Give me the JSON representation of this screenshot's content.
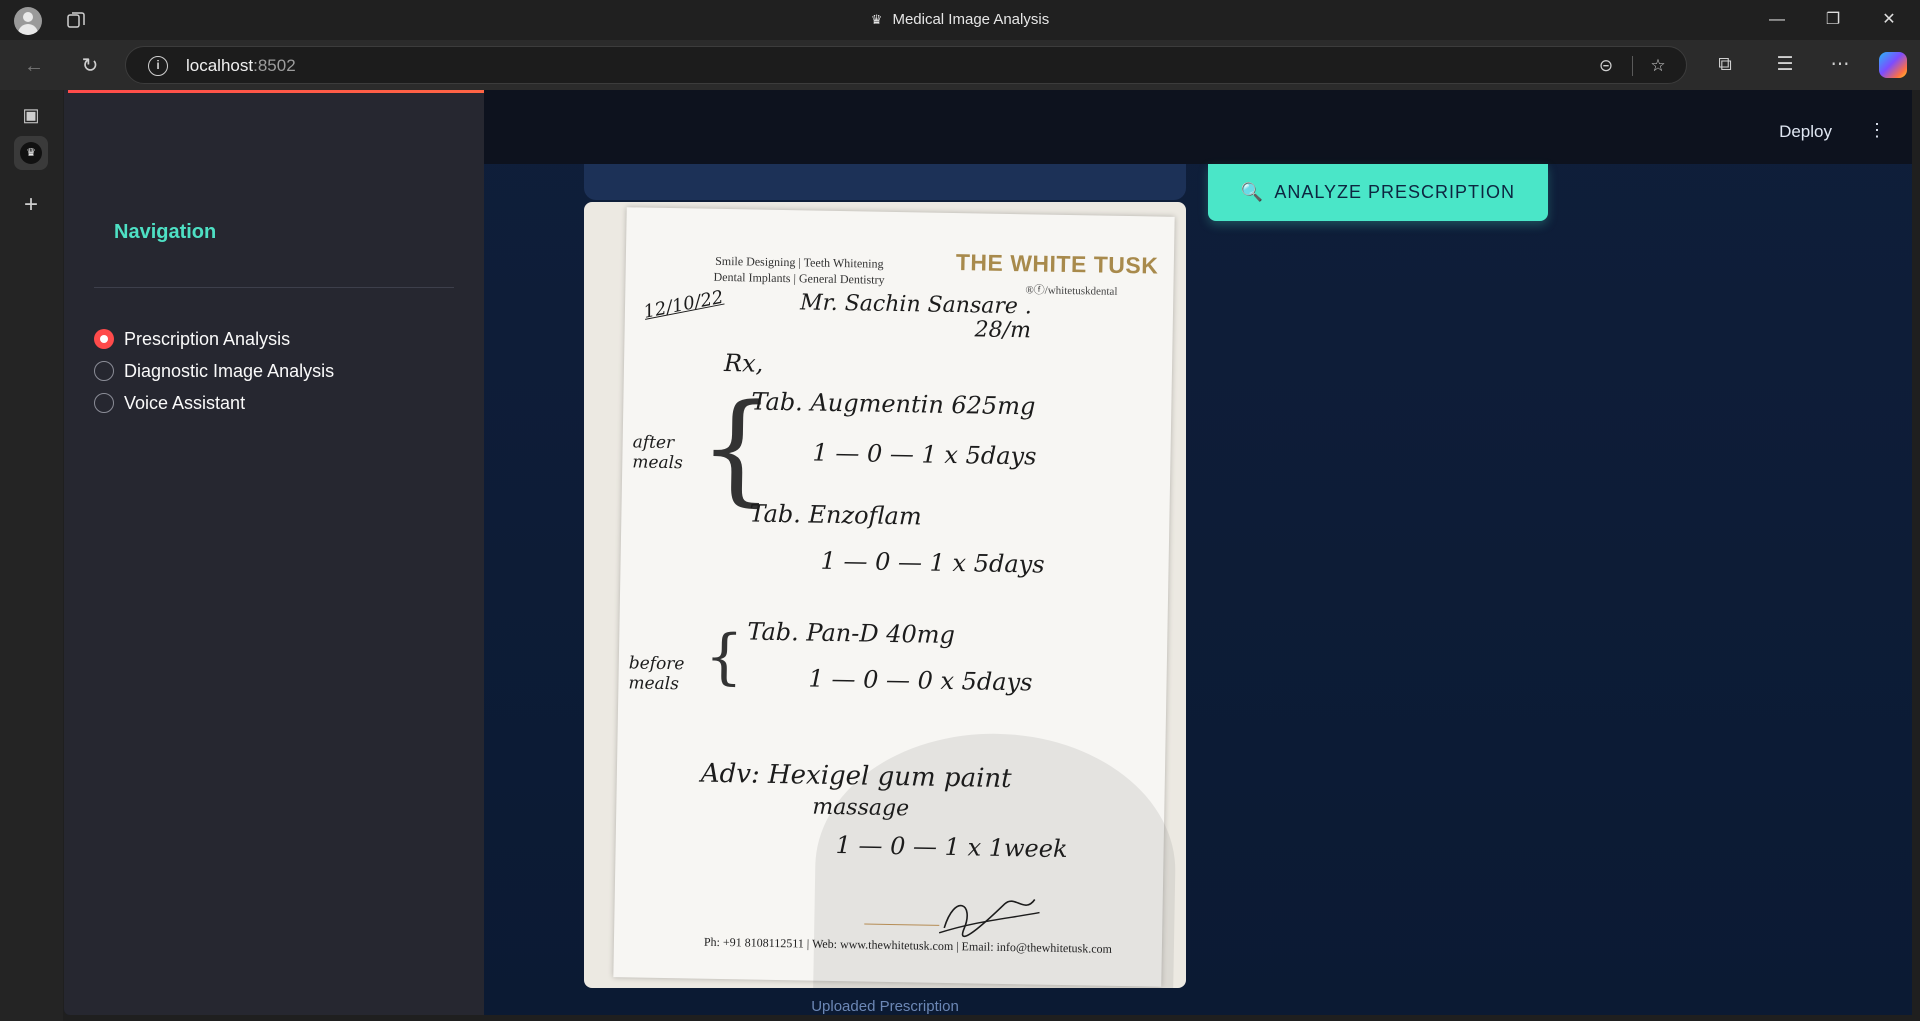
{
  "window": {
    "title": "Medical Image Analysis"
  },
  "address": {
    "host": "localhost",
    "port": ":8502"
  },
  "sidebar": {
    "title": "Navigation",
    "options": [
      {
        "label": "Prescription Analysis",
        "selected": true
      },
      {
        "label": "Diagnostic Image Analysis",
        "selected": false
      },
      {
        "label": "Voice Assistant",
        "selected": false
      }
    ]
  },
  "header": {
    "deploy_label": "Deploy"
  },
  "main": {
    "analyze_button": "ANALYZE PRESCRIPTION",
    "image_caption": "Uploaded Prescription"
  },
  "prescription": {
    "clinic_tagline_1": "Smile Designing | Teeth Whitening",
    "clinic_tagline_2": "Dental Implants | General Dentistry",
    "logo_text": "THE WHITE TUSK",
    "handle": "®ⓕ/whitetuskdental",
    "date": "12/10/22",
    "patient": "Mr. Sachin Sansare .",
    "age_sex": "28/m",
    "rx": "Rx,",
    "group_after": "after meals",
    "med1": "Tab. Augmentin 625mg",
    "dose1": "1 — 0 — 1   x 5days",
    "med2": "Tab. Enzoflam",
    "dose2": "1 — 0 — 1   x 5days",
    "group_before": "before meals",
    "med3": "Tab. Pan-D 40mg",
    "dose3": "1 — 0 — 0   x 5days",
    "advice": "Adv: Hexigel gum paint",
    "advice2": "massage",
    "dose4": "1 — 0 — 1   x 1week",
    "footer": "Ph: +91 8108112511 | Web: www.thewhitetusk.com | Email: info@thewhitetusk.com"
  }
}
